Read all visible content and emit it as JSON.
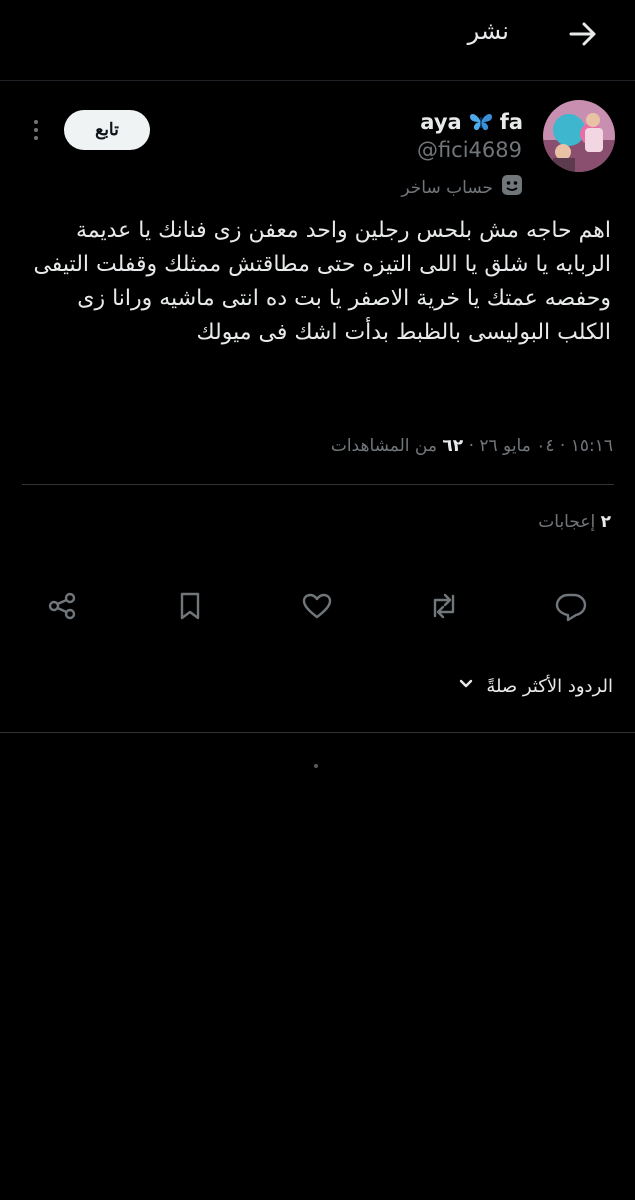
{
  "header": {
    "title": "نشر",
    "back_icon": "arrow-right-icon"
  },
  "author": {
    "display_name_left": "aya",
    "display_name_right": "fa",
    "name_emoji": "butterfly-icon",
    "handle": "@fici4689",
    "badge_label": "حساب ساخر",
    "badge_icon": "theater-masks-icon",
    "follow_label": "تابع"
  },
  "post": {
    "text": "اهم حاجه مش بلحس رجلين واحد معفن زى فنانك يا عديمة الربايه يا شلق يا اللى التيزه حتى مطاقتش ممثلك وقفلت التيفى وحفصه عمتك يا خرية الاصفر يا بت ده انتى ماشيه ورانا زى الكلب البوليسى بالظبط بدأت اشك فى ميولك",
    "timestamp": "١٥:١٦ · ٠٤ مايو ٢٦ ·",
    "views_count": "٦٢",
    "views_label": "من المشاهدات",
    "likes_count": "٢",
    "likes_label": "إعجابات"
  },
  "actions": {
    "reply_icon": "reply-icon",
    "repost_icon": "repost-icon",
    "like_icon": "heart-icon",
    "bookmark_icon": "bookmark-icon",
    "share_icon": "share-icon"
  },
  "replies": {
    "sort_label": "الردود الأكثر صلةً",
    "sort_icon": "chevron-down-icon"
  },
  "colors": {
    "background": "#000000",
    "text_primary": "#e7e9ea",
    "text_secondary": "#71767b",
    "divider": "#2f3336",
    "follow_button_bg": "#eff3f4"
  }
}
